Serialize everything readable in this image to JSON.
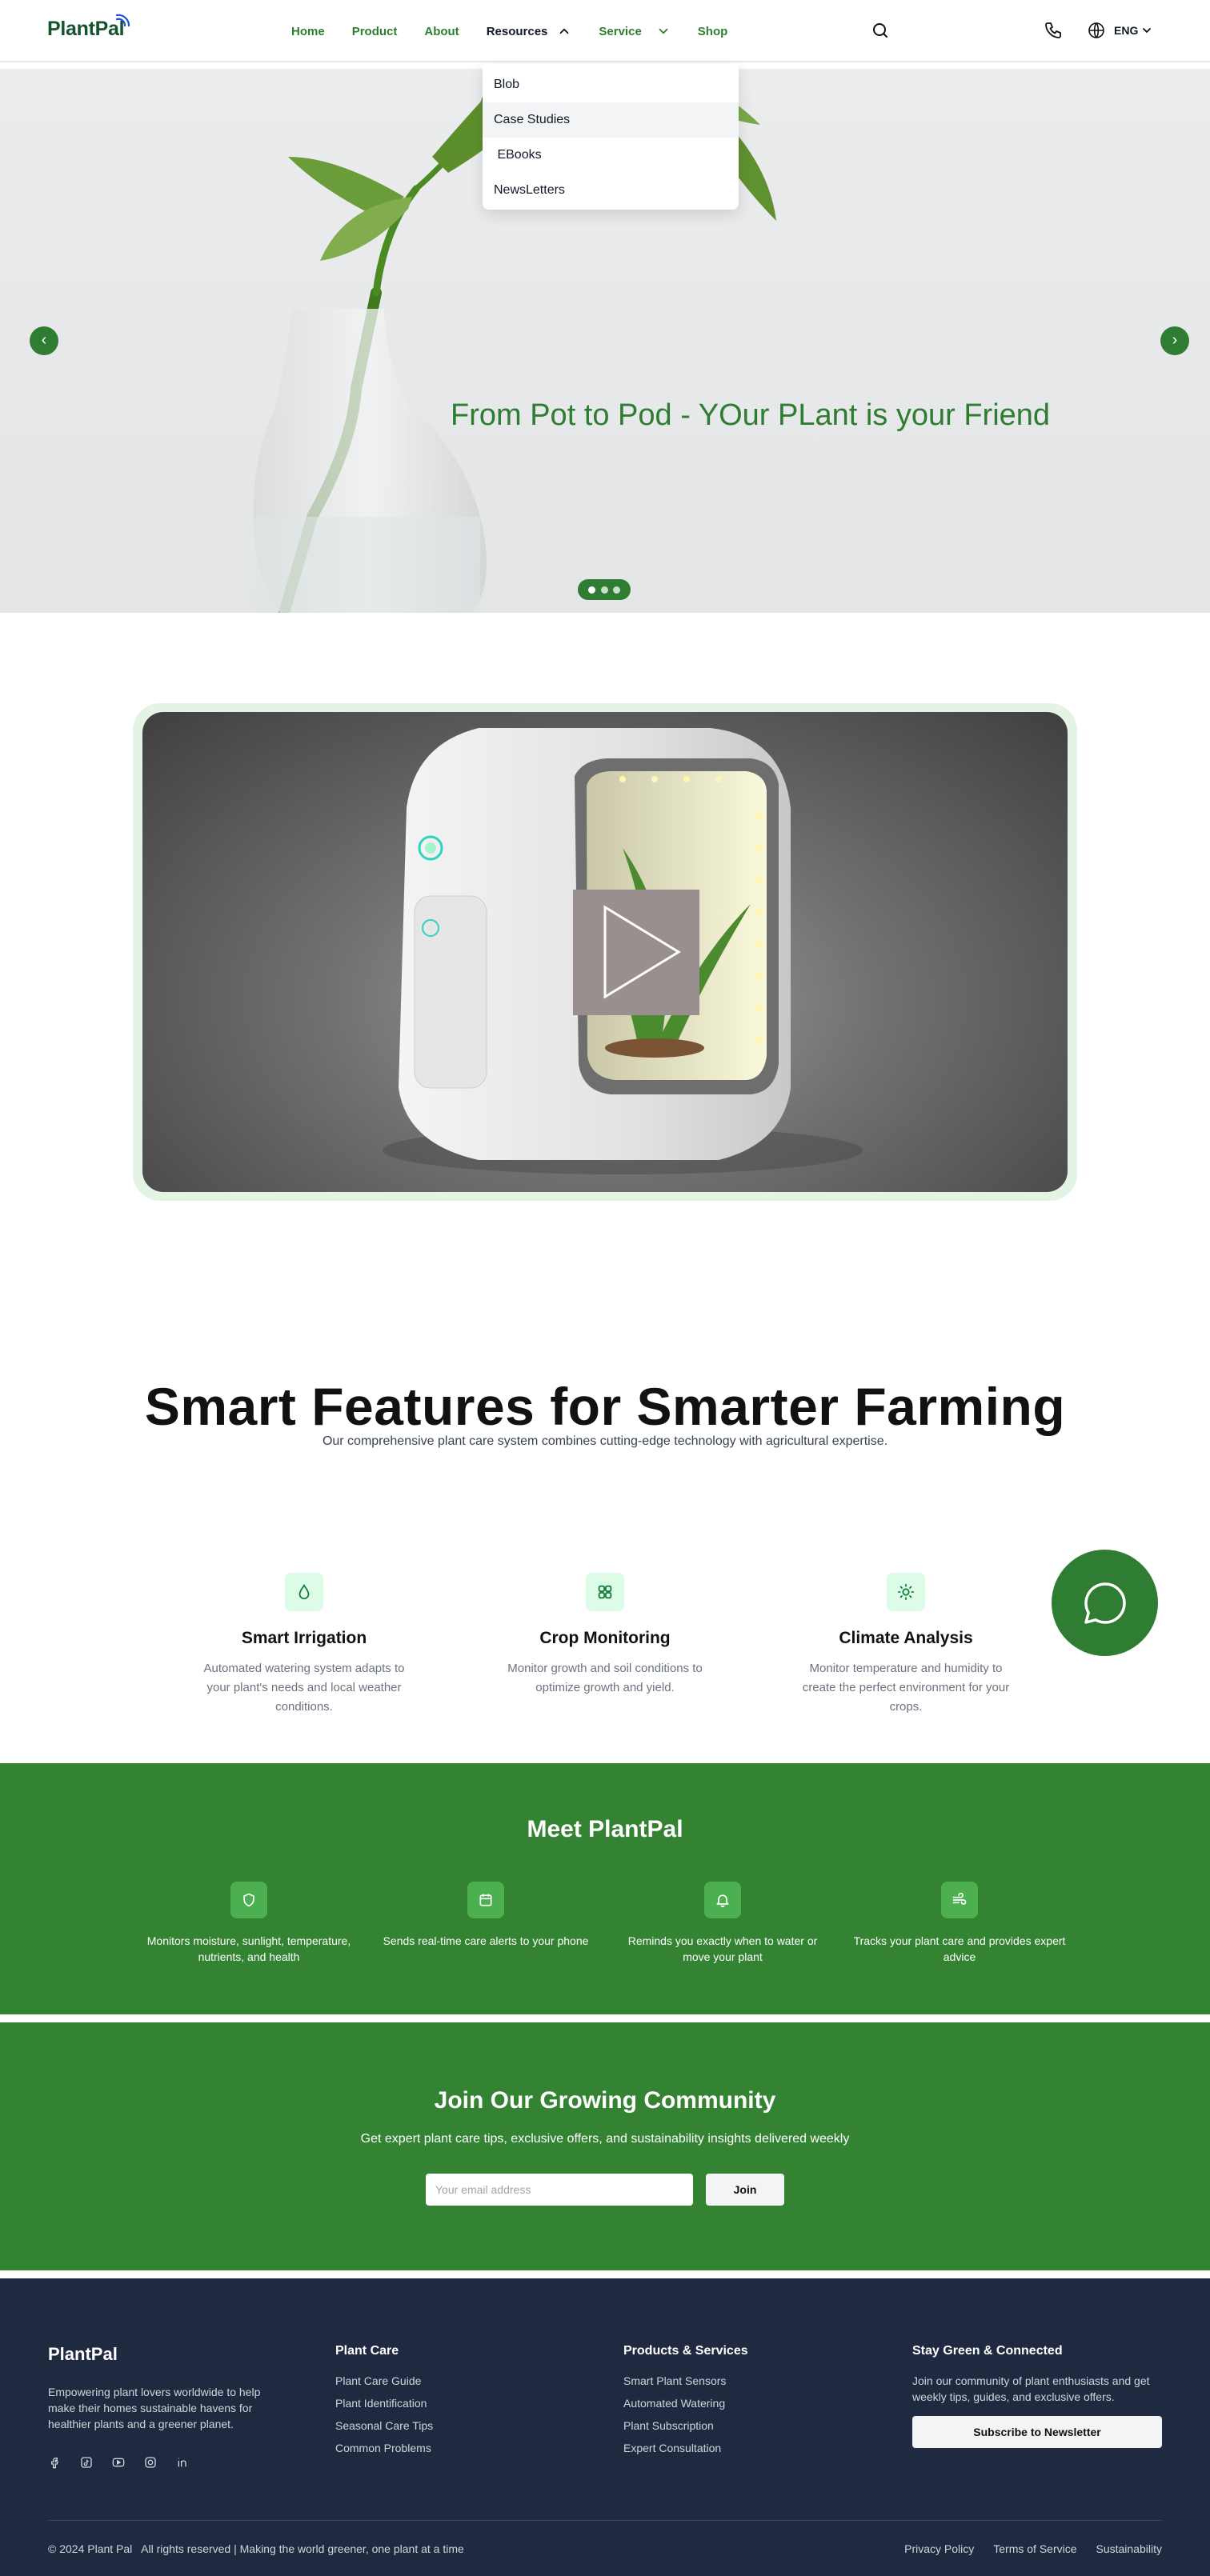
{
  "colors": {
    "brand_green": "#2e7d32",
    "section_green": "#338333",
    "footer_bg": "#1f2a40",
    "icon_bg_light": "#dcfce7"
  },
  "nav": {
    "logo": "PlantPal",
    "links": [
      {
        "label": "Home",
        "active": false
      },
      {
        "label": "Product",
        "active": false
      },
      {
        "label": "About",
        "active": false
      },
      {
        "label": "Resources",
        "active": true,
        "expanded": true
      },
      {
        "label": "Service",
        "active": false,
        "has_dropdown": true
      },
      {
        "label": "Shop",
        "active": false
      }
    ],
    "language": "ENG",
    "icons": [
      "search-icon",
      "phone-icon",
      "globe-icon"
    ]
  },
  "resources_menu": {
    "items": [
      "Blob",
      "Case Studies",
      " EBooks",
      "NewsLetters"
    ],
    "highlighted_index": 1
  },
  "hero": {
    "title": "From Pot to Pod - YOur PLant is your Friend",
    "prev_label": "‹",
    "next_label": "›",
    "slide_count": 3
  },
  "video": {
    "play_icon": "play-icon"
  },
  "features": {
    "title": "Smart Features for Smarter Farming",
    "subtitle": "Our comprehensive plant care system combines cutting-edge technology with agricultural expertise.",
    "items": [
      {
        "icon": "droplet-icon",
        "title": "Smart Irrigation",
        "text": "Automated watering system adapts to your plant's needs and local weather conditions."
      },
      {
        "icon": "grid-icon",
        "title": "Crop Monitoring",
        "text": "Monitor growth and soil conditions to optimize growth and yield."
      },
      {
        "icon": "sun-icon",
        "title": "Climate Analysis",
        "text": "Monitor temperature and humidity to create the perfect environment for your crops."
      }
    ]
  },
  "meet": {
    "title": "Meet PlantPal",
    "items": [
      {
        "icon": "shield-icon",
        "text": "Monitors moisture, sunlight, temperature, nutrients, and health"
      },
      {
        "icon": "calendar-icon",
        "text": "Sends real-time care alerts to your phone"
      },
      {
        "icon": "bell-icon",
        "text": "Reminds you exactly when to water or move your plant"
      },
      {
        "icon": "wind-icon",
        "text": "Tracks your plant care and provides expert advice"
      }
    ]
  },
  "community": {
    "title": "Join Our Growing Community",
    "subtitle": "Get expert plant care tips, exclusive offers, and sustainability insights delivered weekly",
    "email_placeholder": "Your email address",
    "button": "Join"
  },
  "footer": {
    "logo": "PlantPal",
    "description": "Empowering plant lovers worldwide to help make their homes sustainable havens for healthier plants and a greener planet.",
    "social": [
      "facebook-icon",
      "tiktok-icon",
      "youtube-icon",
      "instagram-icon",
      "linkedin-icon"
    ],
    "plant_care": {
      "title": "Plant Care",
      "links": [
        "Plant Care Guide",
        "Plant Identification",
        "Seasonal Care Tips",
        "Common Problems"
      ]
    },
    "products": {
      "title": "Products & Services",
      "links": [
        "Smart Plant Sensors",
        "Automated Watering",
        "Plant Subscription",
        "Expert Consultation"
      ]
    },
    "stay": {
      "title": "Stay Green & Connected",
      "text": "Join our community of plant enthusiasts and get weekly tips, guides, and exclusive offers.",
      "button": "Subscribe to Newsletter"
    },
    "copyright": "© 2024 Plant Pal   All rights reserved | Making the world greener, one plant at a time",
    "legal": [
      "Privacy Policy",
      "Terms of Service",
      "Sustainability"
    ]
  }
}
